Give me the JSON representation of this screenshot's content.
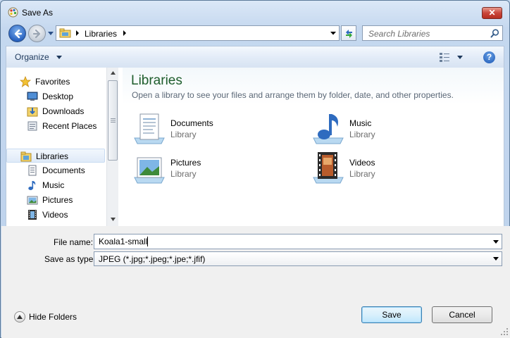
{
  "window": {
    "title": "Save As",
    "close_label": "✕"
  },
  "address": {
    "location": "Libraries"
  },
  "search": {
    "placeholder": "Search Libraries"
  },
  "toolbar": {
    "organize_label": "Organize",
    "help_label": "?"
  },
  "nav": {
    "favorites": [
      {
        "label": "Favorites",
        "icon": "star-icon"
      },
      {
        "label": "Desktop",
        "icon": "desktop-icon"
      },
      {
        "label": "Downloads",
        "icon": "downloads-icon"
      },
      {
        "label": "Recent Places",
        "icon": "recent-places-icon"
      }
    ],
    "libraries": [
      {
        "label": "Libraries",
        "icon": "libraries-icon",
        "selected": true
      },
      {
        "label": "Documents",
        "icon": "documents-icon"
      },
      {
        "label": "Music",
        "icon": "music-icon"
      },
      {
        "label": "Pictures",
        "icon": "pictures-icon"
      },
      {
        "label": "Videos",
        "icon": "videos-icon"
      }
    ]
  },
  "content": {
    "title": "Libraries",
    "subtitle": "Open a library to see your files and arrange them by folder, date, and other properties.",
    "libraries": [
      {
        "name": "Documents",
        "kind": "Library",
        "icon": "documents-library-icon"
      },
      {
        "name": "Music",
        "kind": "Library",
        "icon": "music-library-icon"
      },
      {
        "name": "Pictures",
        "kind": "Library",
        "icon": "pictures-library-icon"
      },
      {
        "name": "Videos",
        "kind": "Library",
        "icon": "videos-library-icon"
      }
    ]
  },
  "form": {
    "filename_label": "File name:",
    "filename_value": "Koala1-small",
    "type_label": "Save as type:",
    "type_value": "JPEG (*.jpg;*.jpeg;*.jpe;*.jfif)"
  },
  "footer": {
    "hide_folders_label": "Hide Folders",
    "save_label": "Save",
    "cancel_label": "Cancel"
  },
  "colors": {
    "title_green": "#1e5d2c",
    "window_frame": "#c5d8ef",
    "save_button_border": "#3c7fb1"
  }
}
